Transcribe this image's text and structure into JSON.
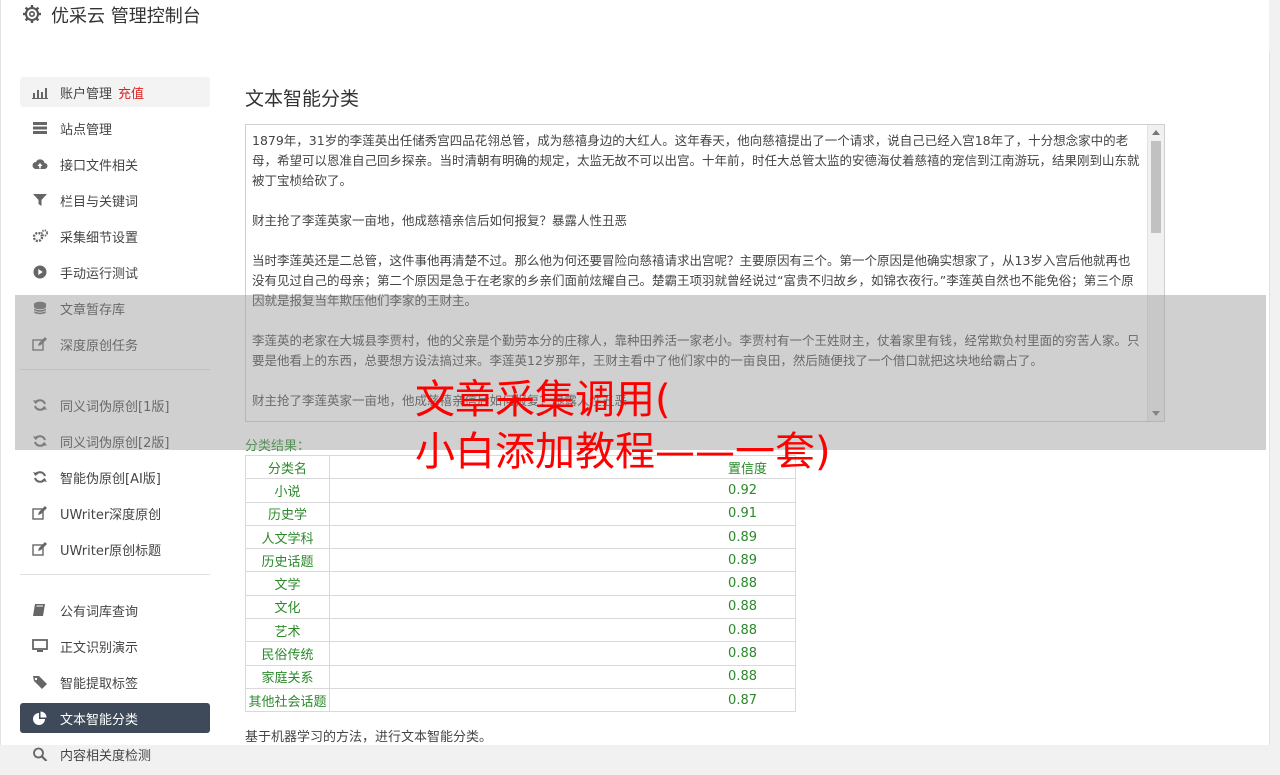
{
  "header": {
    "title": "优采云 管理控制台"
  },
  "sidebar": {
    "groups": [
      [
        {
          "label": "账户管理",
          "extra": "充值",
          "icon": "bar-chart-icon",
          "state": "highlight"
        },
        {
          "label": "站点管理",
          "icon": "server-icon"
        },
        {
          "label": "接口文件相关",
          "icon": "cloud-upload-icon"
        },
        {
          "label": "栏目与关键词",
          "icon": "filter-icon"
        },
        {
          "label": "采集细节设置",
          "icon": "gears-icon"
        },
        {
          "label": "手动运行测试",
          "icon": "play-icon"
        },
        {
          "label": "文章暂存库",
          "icon": "database-icon"
        },
        {
          "label": "深度原创任务",
          "icon": "edit-icon"
        }
      ],
      [
        {
          "label": "同义词伪原创[1版]",
          "icon": "refresh-icon"
        },
        {
          "label": "同义词伪原创[2版]",
          "icon": "refresh-icon"
        },
        {
          "label": "智能伪原创[AI版]",
          "icon": "refresh-icon"
        },
        {
          "label": "UWriter深度原创",
          "icon": "edit-icon"
        },
        {
          "label": "UWriter原创标题",
          "icon": "edit-icon"
        }
      ],
      [
        {
          "label": "公有词库查询",
          "icon": "book-icon"
        },
        {
          "label": "正文识别演示",
          "icon": "monitor-icon"
        },
        {
          "label": "智能提取标签",
          "icon": "tag-icon"
        },
        {
          "label": "文本智能分类",
          "icon": "pie-chart-icon",
          "state": "active"
        },
        {
          "label": "内容相关度检测",
          "icon": "search-icon"
        }
      ]
    ]
  },
  "main": {
    "title": "文本智能分类",
    "article": [
      "1879年，31岁的李莲英出任储秀宫四品花翎总管，成为慈禧身边的大红人。这年春天，他向慈禧提出了一个请求，说自己已经入宫18年了，十分想念家中的老母，希望可以恩准自己回乡探亲。当时清朝有明确的规定，太监无故不可以出宫。十年前，时任大总管太监的安德海仗着慈禧的宠信到江南游玩，结果刚到山东就被丁宝桢给砍了。",
      "财主抢了李莲英家一亩地，他成慈禧亲信后如何报复？暴露人性丑恶",
      "当时李莲英还是二总管，这件事他再清楚不过。那么他为何还要冒险向慈禧请求出宫呢？主要原因有三个。第一个原因是他确实想家了，从13岁入宫后他就再也没有见过自己的母亲；第二个原因是急于在老家的乡亲们面前炫耀自己。楚霸王项羽就曾经说过“富贵不归故乡，如锦衣夜行。”李莲英自然也不能免俗；第三个原因就是报复当年欺压他们李家的王财主。",
      "李莲英的老家在大城县李贾村，他的父亲是个勤劳本分的庄稼人，靠种田养活一家老小。李贾村有一个王姓财主，仗着家里有钱，经常欺负村里面的穷苦人家。只要是他看上的东西，总要想方设法搞过来。李莲英12岁那年，王财主看中了他们家中的一亩良田，然后随便找了一个借口就把这块地给霸占了。",
      "财主抢了李莲英家一亩地，他成慈禧亲信后如何报复？暴露人性丑恶"
    ],
    "result_label": "分类结果：",
    "table": {
      "headers": [
        "分类名",
        "置信度"
      ],
      "rows": [
        [
          "小说",
          "0.92"
        ],
        [
          "历史学",
          "0.91"
        ],
        [
          "人文学科",
          "0.89"
        ],
        [
          "历史话题",
          "0.89"
        ],
        [
          "文学",
          "0.88"
        ],
        [
          "文化",
          "0.88"
        ],
        [
          "艺术",
          "0.88"
        ],
        [
          "民俗传统",
          "0.88"
        ],
        [
          "家庭关系",
          "0.88"
        ],
        [
          "其他社会话题",
          "0.87"
        ]
      ]
    },
    "description": "基于机器学习的方法，进行文本智能分类。"
  },
  "overlay": {
    "line1": "文章采集调用(",
    "line2": "小白添加教程——一套)"
  },
  "colors": {
    "active_bg": "#3e4a59",
    "result_green": "#2a8a2a",
    "recharge_red": "#e02020",
    "overlay_red": "#ff0000"
  }
}
